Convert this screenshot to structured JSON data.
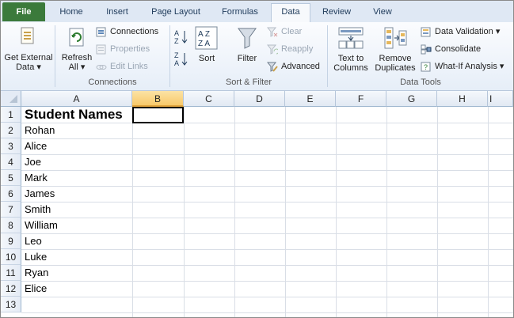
{
  "tabs": {
    "file": "File",
    "home": "Home",
    "insert": "Insert",
    "page_layout": "Page Layout",
    "formulas": "Formulas",
    "data": "Data",
    "review": "Review",
    "view": "View"
  },
  "ribbon": {
    "get_external_data": {
      "line1": "Get External",
      "line2": "Data ▾"
    },
    "refresh_all": {
      "line1": "Refresh",
      "line2": "All ▾"
    },
    "connections": {
      "connections": "Connections",
      "properties": "Properties",
      "edit_links": "Edit Links",
      "group_label": "Connections"
    },
    "sort_filter": {
      "sort": "Sort",
      "filter": "Filter",
      "clear": "Clear",
      "reapply": "Reapply",
      "advanced": "Advanced",
      "group_label": "Sort & Filter",
      "az_top": "A",
      "az_bottom": "Z",
      "za_top": "Z",
      "za_bottom": "A"
    },
    "data_tools": {
      "text_to_columns": {
        "line1": "Text to",
        "line2": "Columns"
      },
      "remove_duplicates": {
        "line1": "Remove",
        "line2": "Duplicates"
      },
      "data_validation": "Data Validation ▾",
      "consolidate": "Consolidate",
      "what_if": "What-If Analysis ▾",
      "group_label": "Data Tools"
    }
  },
  "sheet": {
    "columns": [
      "A",
      "B",
      "C",
      "D",
      "E",
      "F",
      "G",
      "H",
      "I"
    ],
    "rows": [
      "1",
      "2",
      "3",
      "4",
      "5",
      "6",
      "7",
      "8",
      "9",
      "10",
      "11",
      "12",
      "13"
    ],
    "selected_column": "B",
    "cells_A": [
      "Student Names",
      "Rohan",
      "Alice",
      "Joe",
      "Mark",
      "James",
      "Smith",
      "William",
      "Leo",
      "Luke",
      "Ryan",
      "Elice",
      ""
    ]
  },
  "colors": {
    "file_tab": "#3b7a3b",
    "selected_header": "#f8c96a",
    "ribbon_bg": "#e6eef8"
  }
}
